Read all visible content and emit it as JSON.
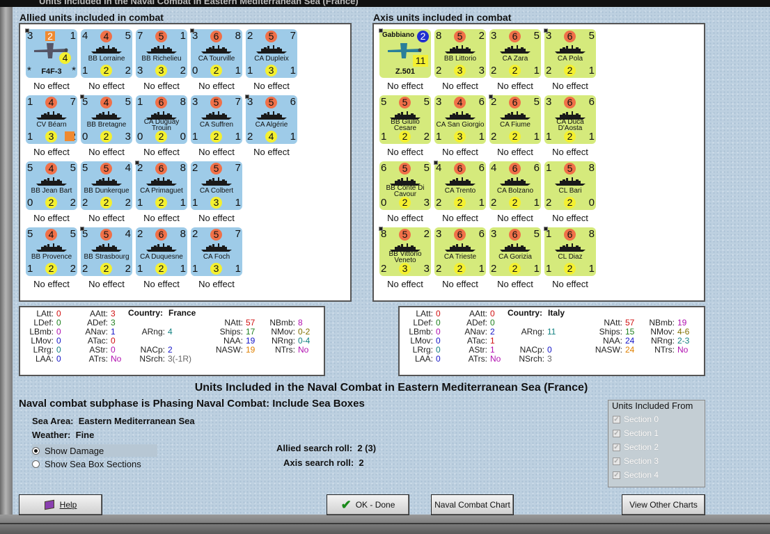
{
  "window": {
    "title": "Units Included in the Naval Combat in Eastern Mediterranean Sea (France)"
  },
  "allied": {
    "title": "Allied units included in combat",
    "units": [
      {
        "name": "F4F-3",
        "tl": "3",
        "top": "2",
        "tr": "1",
        "bot": "4",
        "bl": "*",
        "br": "*",
        "effect": "No effect"
      },
      {
        "name": "BB Lorraine",
        "tl": "4",
        "top": "4",
        "tr": "5",
        "bot": "2",
        "bl": "1",
        "br": "2",
        "effect": "No effect"
      },
      {
        "name": "BB Richelieu",
        "tl": "7",
        "top": "5",
        "tr": "1",
        "bot": "3",
        "bl": "3",
        "br": "2",
        "effect": "No effect"
      },
      {
        "name": "CA Tourville",
        "tl": "3",
        "top": "6",
        "tr": "8",
        "bot": "2",
        "bl": "0",
        "br": "1",
        "effect": "No effect"
      },
      {
        "name": "CA Dupleix",
        "tl": "2",
        "top": "5",
        "tr": "7",
        "bot": "3",
        "bl": "1",
        "br": "1",
        "effect": "No effect"
      },
      {
        "name": "CV Béarn",
        "tl": "1",
        "top": "4",
        "tr": "7",
        "bot": "3",
        "bl": "1",
        "br": "2",
        "effect": "No effect"
      },
      {
        "name": "BB Bretagne",
        "tl": "5",
        "top": "4",
        "tr": "5",
        "bot": "2",
        "bl": "0",
        "br": "3",
        "effect": "No effect"
      },
      {
        "name": "CA Duguay Trouin",
        "tl": "1",
        "top": "6",
        "tr": "8",
        "bot": "2",
        "bl": "0",
        "br": "0",
        "effect": "No effect"
      },
      {
        "name": "CA Suffren",
        "tl": "3",
        "top": "5",
        "tr": "7",
        "bot": "2",
        "bl": "1",
        "br": "1",
        "effect": "No effect"
      },
      {
        "name": "CA Algérie",
        "tl": "3",
        "top": "5",
        "tr": "6",
        "bot": "4",
        "bl": "2",
        "br": "1",
        "effect": "No effect"
      },
      {
        "name": "BB Jean Bart",
        "tl": "5",
        "top": "4",
        "tr": "5",
        "bot": "2",
        "bl": "0",
        "br": "2",
        "effect": "No effect"
      },
      {
        "name": "BB Dunkerque",
        "tl": "5",
        "top": "5",
        "tr": "4",
        "bot": "2",
        "bl": "2",
        "br": "2",
        "effect": "No effect"
      },
      {
        "name": "CA Primaguet",
        "tl": "2",
        "top": "6",
        "tr": "8",
        "bot": "2",
        "bl": "1",
        "br": "1",
        "effect": "No effect"
      },
      {
        "name": "CA Colbert",
        "tl": "2",
        "top": "5",
        "tr": "7",
        "bot": "3",
        "bl": "1",
        "br": "1",
        "effect": "No effect"
      },
      {
        "name": "BB Provence",
        "tl": "5",
        "top": "4",
        "tr": "5",
        "bot": "2",
        "bl": "1",
        "br": "2",
        "effect": "No effect"
      },
      {
        "name": "BB Strasbourg",
        "tl": "5",
        "top": "5",
        "tr": "4",
        "bot": "2",
        "bl": "2",
        "br": "2",
        "effect": "No effect"
      },
      {
        "name": "CA Duquesne",
        "tl": "2",
        "top": "6",
        "tr": "8",
        "bot": "2",
        "bl": "1",
        "br": "1",
        "effect": "No effect"
      },
      {
        "name": "CA Foch",
        "tl": "2",
        "top": "5",
        "tr": "7",
        "bot": "3",
        "bl": "1",
        "br": "1",
        "effect": "No effect"
      }
    ]
  },
  "axis": {
    "title": "Axis units included in combat",
    "units": [
      {
        "name": "Z.501",
        "label": "Gabbiano",
        "tl": "",
        "top": "2",
        "tr": "",
        "bot": "11",
        "bl": "",
        "br": "",
        "effect": "No effect"
      },
      {
        "name": "BB Littorio",
        "tl": "8",
        "top": "5",
        "tr": "2",
        "bot": "3",
        "bl": "2",
        "br": "3",
        "effect": "No effect"
      },
      {
        "name": "CA Zara",
        "tl": "3",
        "top": "6",
        "tr": "5",
        "bot": "2",
        "bl": "2",
        "br": "1",
        "effect": "No effect"
      },
      {
        "name": "CA Pola",
        "tl": "3",
        "top": "6",
        "tr": "5",
        "bot": "2",
        "bl": "2",
        "br": "1",
        "effect": "No effect"
      },
      {
        "name": "BB Giulio Cesare",
        "tl": "5",
        "top": "5",
        "tr": "5",
        "bot": "2",
        "bl": "1",
        "br": "2",
        "effect": "No effect"
      },
      {
        "name": "CA San Giorgio",
        "tl": "3",
        "top": "4",
        "tr": "6",
        "bot": "3",
        "bl": "1",
        "br": "1",
        "effect": "No effect"
      },
      {
        "name": "CA Fiume",
        "tl": "2",
        "top": "6",
        "tr": "5",
        "bot": "2",
        "bl": "2",
        "br": "1",
        "effect": "No effect"
      },
      {
        "name": "CA Duca D'Aosta",
        "tl": "3",
        "top": "6",
        "tr": "6",
        "bot": "2",
        "bl": "1",
        "br": "1",
        "effect": "No effect"
      },
      {
        "name": "BB Conte Di Cavour",
        "tl": "6",
        "top": "5",
        "tr": "5",
        "bot": "2",
        "bl": "0",
        "br": "3",
        "effect": "No effect"
      },
      {
        "name": "CA Trento",
        "tl": "4",
        "top": "6",
        "tr": "6",
        "bot": "2",
        "bl": "2",
        "br": "1",
        "effect": "No effect"
      },
      {
        "name": "CA Bolzano",
        "tl": "4",
        "top": "6",
        "tr": "6",
        "bot": "2",
        "bl": "2",
        "br": "1",
        "effect": "No effect"
      },
      {
        "name": "CL Bari",
        "tl": "1",
        "top": "5",
        "tr": "8",
        "bot": "2",
        "bl": "2",
        "br": "0",
        "effect": "No effect"
      },
      {
        "name": "BB Vittorio Veneto",
        "tl": "8",
        "top": "5",
        "tr": "2",
        "bot": "3",
        "bl": "2",
        "br": "3",
        "effect": "No effect"
      },
      {
        "name": "CA Trieste",
        "tl": "3",
        "top": "6",
        "tr": "6",
        "bot": "2",
        "bl": "2",
        "br": "1",
        "effect": "No effect"
      },
      {
        "name": "CA Gorizia",
        "tl": "3",
        "top": "6",
        "tr": "5",
        "bot": "2",
        "bl": "2",
        "br": "1",
        "effect": "No effect"
      },
      {
        "name": "CL Diaz",
        "tl": "1",
        "top": "6",
        "tr": "8",
        "bot": "2",
        "bl": "1",
        "br": "1",
        "effect": "No effect"
      }
    ]
  },
  "allied_stats": {
    "country_label": "Country:",
    "country": "France",
    "LAtt": "0",
    "LDef": "0",
    "LBmb": "0",
    "LMov": "0",
    "LRrg": "0",
    "LAA": "0",
    "AAtt": "3",
    "ADef": "3",
    "ANav": "1",
    "ATac": "0",
    "AStr": "0",
    "ATrs": "No",
    "ARng": "4",
    "NACp": "2",
    "NSrch": "3(-1R)",
    "NAtt": "57",
    "Ships": "17",
    "NAA": "19",
    "NASW": "19",
    "NBmb": "8",
    "NMov": "0-2",
    "NRng": "0-4",
    "NTrs": "No"
  },
  "axis_stats": {
    "country_label": "Country:",
    "country": "Italy",
    "LAtt": "0",
    "LDef": "0",
    "LBmb": "0",
    "LMov": "0",
    "LRrg": "0",
    "LAA": "0",
    "AAtt": "0",
    "ADef": "0",
    "ANav": "2",
    "ATac": "1",
    "AStr": "1",
    "ATrs": "No",
    "ARng": "11",
    "NACp": "0",
    "NSrch": "3",
    "NAtt": "57",
    "Ships": "15",
    "NAA": "24",
    "NASW": "24",
    "NBmb": "19",
    "NMov": "4-6",
    "NRng": "2-3",
    "NTrs": "No"
  },
  "stat_labels": {
    "LAtt": "LAtt:",
    "LDef": "LDef:",
    "LBmb": "LBmb:",
    "LMov": "LMov:",
    "LRrg": "LRrg:",
    "LAA": "LAA:",
    "AAtt": "AAtt:",
    "ADef": "ADef:",
    "ANav": "ANav:",
    "ATac": "ATac:",
    "AStr": "AStr:",
    "ATrs": "ATrs:",
    "ARng": "ARng:",
    "NACp": "NACp:",
    "NSrch": "NSrch:",
    "NAtt": "NAtt:",
    "Ships": "Ships:",
    "NAA": "NAA:",
    "NASW": "NASW:",
    "NBmb": "NBmb:",
    "NMov": "NMov:",
    "NRng": "NRng:",
    "NTrs": "NTrs:"
  },
  "summary": {
    "title": "Units Included in the Naval Combat in Eastern Mediterranean Sea (France)",
    "subphase": "Naval combat subphase is Phasing Naval Combat: Include Sea Boxes",
    "sea_area_label": "Sea Area:",
    "sea_area": "Eastern Mediterranean Sea",
    "weather_label": "Weather:",
    "weather": "Fine",
    "allied_roll_label": "Allied search roll:",
    "allied_roll": "2 (3)",
    "axis_roll_label": "Axis search roll:",
    "axis_roll": "2"
  },
  "options": {
    "show_damage": "Show Damage",
    "show_sections": "Show Sea Box Sections",
    "selected": "show_damage"
  },
  "sections": {
    "title": "Units Included From",
    "items": [
      "Section 0",
      "Section 1",
      "Section 2",
      "Section 3",
      "Section 4"
    ]
  },
  "buttons": {
    "help": "Help",
    "ok": "OK - Done",
    "chart": "Naval Combat Chart",
    "other": "View Other Charts"
  },
  "colors": {
    "allied_counter": "#9ecbe8",
    "axis_counter": "#d5ea7c",
    "attack_circle": "#f07048",
    "aa_circle": "#f4f030"
  }
}
